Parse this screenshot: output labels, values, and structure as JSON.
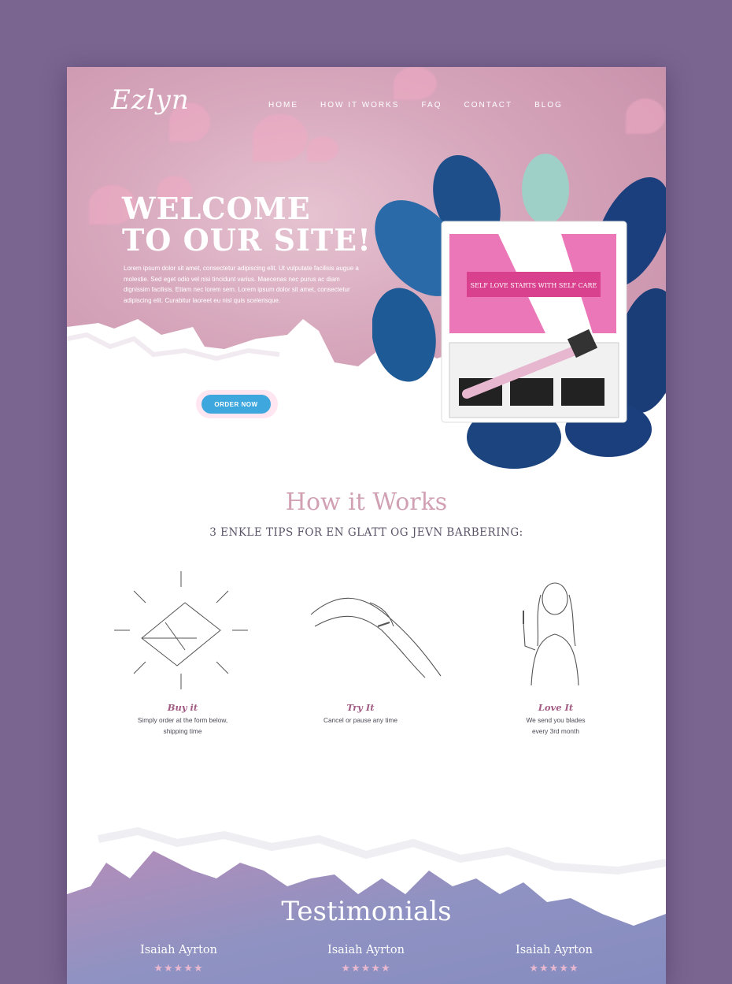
{
  "brand": {
    "logo": "Ezlyn"
  },
  "nav": {
    "items": [
      "HOME",
      "HOW IT WORKS",
      "FAQ",
      "CONTACT",
      "BLOG"
    ]
  },
  "hero": {
    "title_line1": "WELCOME",
    "title_line2": "TO OUR SITE!",
    "body": "Lorem ipsum dolor sit amet, consectetur adipiscing elit. Ut vulputate facilisis augue a molestie. Sed eget odio vel nisi tincidunt varius. Maecenas nec purus ac diam dignissim facilisis. Etiam nec lorem sem. Lorem ipsum dolor sit amet, consectetur adipiscing elit. Curabitur laoreet eu nisl quis scelerisque.",
    "cta": "ORDER NOW",
    "box_banner": "SELF LOVE STARTS WITH SELF CARE"
  },
  "how": {
    "title": "How it Works",
    "subtitle": "3 ENKLE TIPS FOR EN GLATT OG JEVN BARBERING:",
    "steps": [
      {
        "title": "Buy it",
        "line1": "Simply order at the form below,",
        "line2": "shipping time"
      },
      {
        "title": "Try It",
        "line1": "Cancel or pause any time",
        "line2": ""
      },
      {
        "title": "Love It",
        "line1": "We send you blades",
        "line2": "every 3rd month"
      }
    ]
  },
  "testimonials": {
    "title": "Testimonials",
    "items": [
      {
        "name": "Isaiah Ayrton",
        "stars": "★★★★★"
      },
      {
        "name": "Isaiah Ayrton",
        "stars": "★★★★★"
      },
      {
        "name": "Isaiah Ayrton",
        "stars": "★★★★★"
      }
    ]
  },
  "colors": {
    "accent_blue": "#3ea7de",
    "pink": "#d1a1b3",
    "hero_pink": "#d7a7bc",
    "footer_purple": "#8b8dc0"
  }
}
